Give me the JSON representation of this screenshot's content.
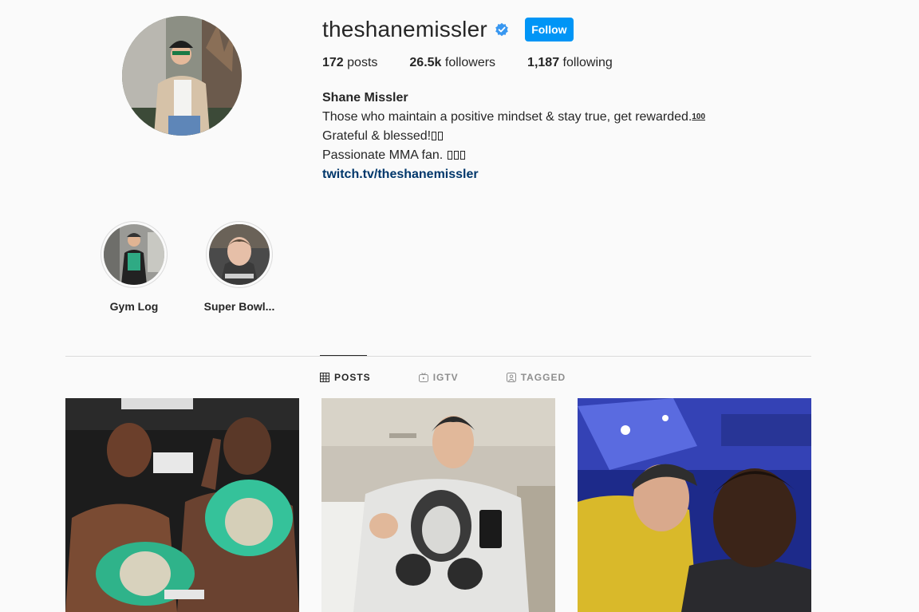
{
  "profile": {
    "username": "theshanemissler",
    "verified_icon": "verified-badge-icon",
    "follow_label": "Follow",
    "stats": {
      "posts_count": "172",
      "posts_label": "posts",
      "followers_count": "26.5k",
      "followers_label": "followers",
      "following_count": "1,187",
      "following_label": "following"
    },
    "full_name": "Shane Missler",
    "bio_line1": "Those who maintain a positive mindset & stay true, get rewarded.",
    "bio_line1_emoji": "100",
    "bio_line2": "Grateful & blessed!",
    "bio_line3": "Passionate MMA fan.",
    "link": "twitch.tv/theshanemissler"
  },
  "highlights": [
    {
      "label": "Gym Log"
    },
    {
      "label": "Super Bowl..."
    }
  ],
  "tabs": [
    {
      "label": "POSTS",
      "icon": "grid-icon",
      "active": true
    },
    {
      "label": "IGTV",
      "icon": "igtv-icon",
      "active": false
    },
    {
      "label": "TAGGED",
      "icon": "tagged-icon",
      "active": false
    }
  ],
  "colors": {
    "accent": "#0095f6",
    "link": "#00376b",
    "background": "#fafafa"
  }
}
